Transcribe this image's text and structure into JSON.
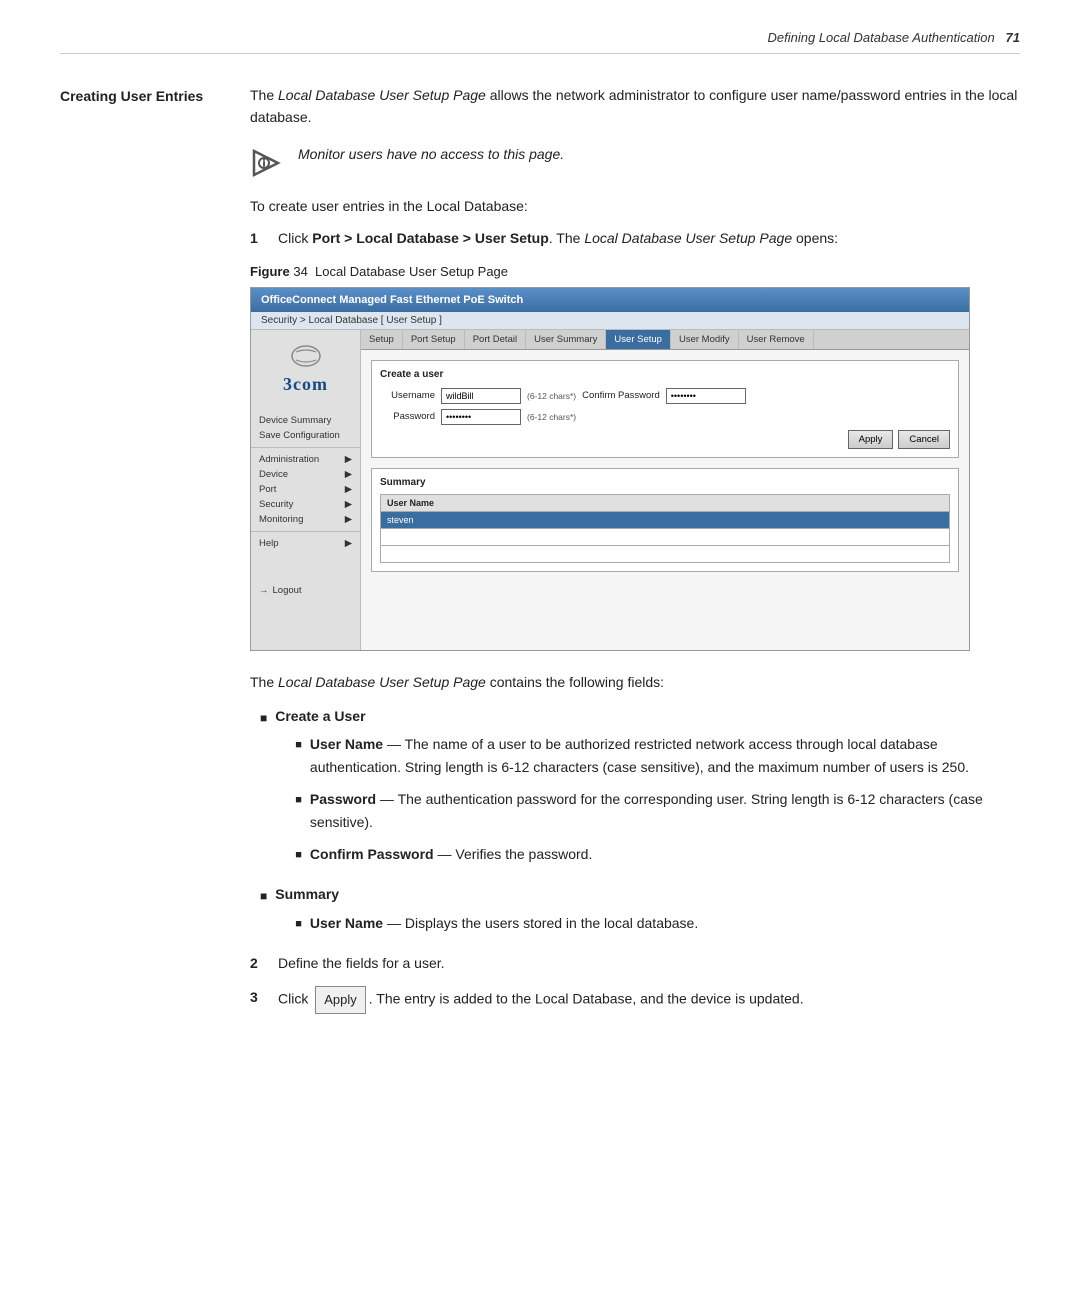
{
  "header": {
    "text": "Defining Local Database Authentication",
    "page_number": "71"
  },
  "section": {
    "label": "Creating User Entries",
    "intro": "The Local Database User Setup Page allows the network administrator to configure user name/password entries in the local database.",
    "intro_em": "Local Database User Setup Page",
    "info_note": "Monitor users have no access to this page.",
    "steps_intro": "To create user entries in the Local Database:",
    "step1_prefix": "Click ",
    "step1_link": "Port > Local Database > User Setup",
    "step1_suffix": ". The ",
    "step1_em1": "Local Database User",
    "step1_em2": "Setup Page",
    "step1_end": " opens:"
  },
  "figure": {
    "number": "34",
    "caption": "Local Database User Setup Page"
  },
  "switch_ui": {
    "app_title": "OfficeConnect Managed Fast Ethernet PoE Switch",
    "breadcrumb": "Security > Local Database [ User Setup ]",
    "tabs": [
      "Setup",
      "Port Setup",
      "Port Detail",
      "User Summary",
      "User Setup",
      "User Modify",
      "User Remove"
    ],
    "active_tab": "User Setup",
    "sidebar": {
      "logo": "3com",
      "items": [
        "Device Summary",
        "Save Configuration",
        "Administration",
        "Device",
        "Port",
        "Security",
        "Monitoring",
        "Help"
      ],
      "logout": "Logout"
    },
    "form": {
      "title": "Create a user",
      "username_label": "Username",
      "username_value": "wildBill",
      "password_label": "Password",
      "password_value": "••••••••",
      "hint1": "(6-12 chars*)",
      "hint2": "(6-12 chars*)",
      "confirm_label": "Confirm Password",
      "confirm_value": "••••••••",
      "apply_button": "Apply",
      "cancel_button": "Cancel"
    },
    "summary": {
      "title": "Summary",
      "column": "User Name",
      "rows": [
        "steven",
        "",
        ""
      ]
    }
  },
  "description": {
    "intro": "The Local Database User Setup Page contains the following fields:",
    "intro_em": "Local Database User Setup Page",
    "sections": [
      {
        "title": "Create a User",
        "items": [
          {
            "term": "User Name",
            "desc": "The name of a user to be authorized restricted network access through local database authentication. String length is 6-12 characters (case sensitive), and the maximum number of users is 250."
          },
          {
            "term": "Password",
            "desc": "The authentication password for the corresponding user. String length is 6-12 characters (case sensitive)."
          },
          {
            "term": "Confirm Password",
            "desc": "Verifies the password."
          }
        ]
      },
      {
        "title": "Summary",
        "items": [
          {
            "term": "User Name",
            "desc": "Displays the users stored in the local database."
          }
        ]
      }
    ]
  },
  "steps_footer": [
    {
      "num": "2",
      "text": "Define the fields for a user."
    },
    {
      "num": "3",
      "text_prefix": "Click ",
      "button_label": "Apply",
      "text_suffix": ". The entry is added to the Local Database, and the device is updated."
    }
  ]
}
